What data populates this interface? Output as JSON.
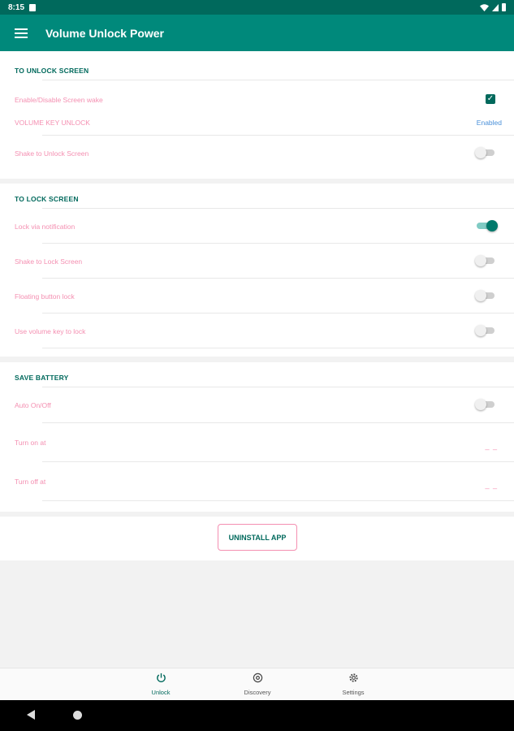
{
  "status_bar": {
    "time": "8:15"
  },
  "app_bar": {
    "title": "Volume Unlock Power"
  },
  "unlock_section": {
    "title": "TO UNLOCK SCREEN",
    "screen_wake_label": "Enable/Disable Screen wake",
    "screen_wake_checked": true,
    "volume_key_label": "VOLUME KEY UNLOCK",
    "volume_key_status": "Enabled",
    "shake_unlock_label": "Shake to Unlock Screen",
    "shake_unlock_on": false
  },
  "lock_section": {
    "title": "TO LOCK SCREEN",
    "items": [
      {
        "label": "Lock via notification",
        "on": true
      },
      {
        "label": "Shake to Lock Screen",
        "on": false
      },
      {
        "label": "Floating button lock",
        "on": false
      },
      {
        "label": "Use volume key to lock",
        "on": false
      }
    ]
  },
  "battery_section": {
    "title": "SAVE BATTERY",
    "auto_label": "Auto On/Off",
    "auto_on": false,
    "turn_on_label": "Turn on at",
    "turn_on_value": "_ _",
    "turn_off_label": "Turn off at",
    "turn_off_value": "_ _"
  },
  "uninstall_label": "UNINSTALL APP",
  "bottom_nav": [
    {
      "label": "Unlock",
      "icon": "power-icon",
      "active": true
    },
    {
      "label": "Discovery",
      "icon": "discovery-icon",
      "active": false
    },
    {
      "label": "Settings",
      "icon": "settings-gear-icon",
      "active": false
    }
  ],
  "colors": {
    "primary": "#00897b",
    "primary_dark": "#00695c",
    "accent_text": "#f48fb1",
    "link_blue": "#4a90d9"
  }
}
